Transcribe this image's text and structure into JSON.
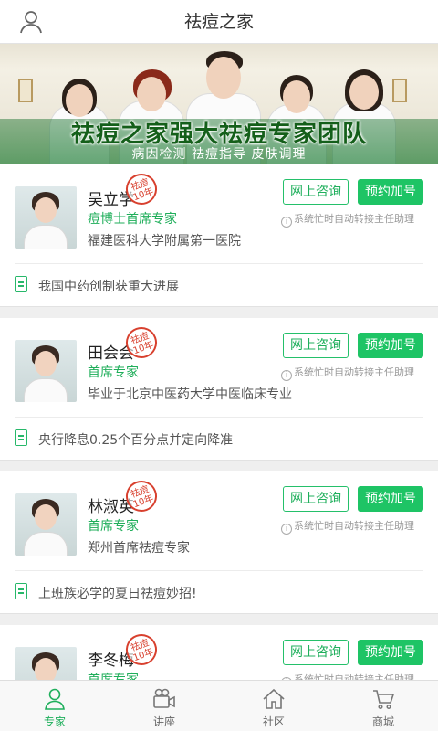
{
  "header": {
    "title": "祛痘之家",
    "user_icon": "user-icon"
  },
  "banner": {
    "headline": "祛痘之家强大祛痘专家团队",
    "subline": "病因检测  祛痘指导  皮肤调理"
  },
  "buttons": {
    "consult": "网上咨询",
    "book": "预约加号"
  },
  "note": "系统忙时自动转接主任助理",
  "stamp": {
    "top": "祛痘",
    "bottom": "10年"
  },
  "doctors": [
    {
      "name": "吴立学",
      "title": "痘博士首席专家",
      "hospital": "福建医科大学附属第一医院",
      "article": "我国中药创制获重大进展"
    },
    {
      "name": "田会会",
      "title": "首席专家",
      "hospital": "毕业于北京中医药大学中医临床专业",
      "article": "央行降息0.25个百分点并定向降准"
    },
    {
      "name": "林淑英",
      "title": "首席专家",
      "hospital": "郑州首席祛痘专家",
      "article": "上班族必学的夏日祛痘妙招!"
    },
    {
      "name": "李冬梅",
      "title": "首席专家",
      "hospital": "",
      "article": ""
    }
  ],
  "tabs": [
    {
      "label": "专家",
      "icon": "person-icon",
      "active": true
    },
    {
      "label": "讲座",
      "icon": "video-camera-icon",
      "active": false
    },
    {
      "label": "社区",
      "icon": "home-icon",
      "active": false
    },
    {
      "label": "商城",
      "icon": "cart-icon",
      "active": false
    }
  ],
  "colors": {
    "accent": "#1ec465",
    "accent_text": "#1faf5c",
    "stamp": "#d8402e"
  }
}
